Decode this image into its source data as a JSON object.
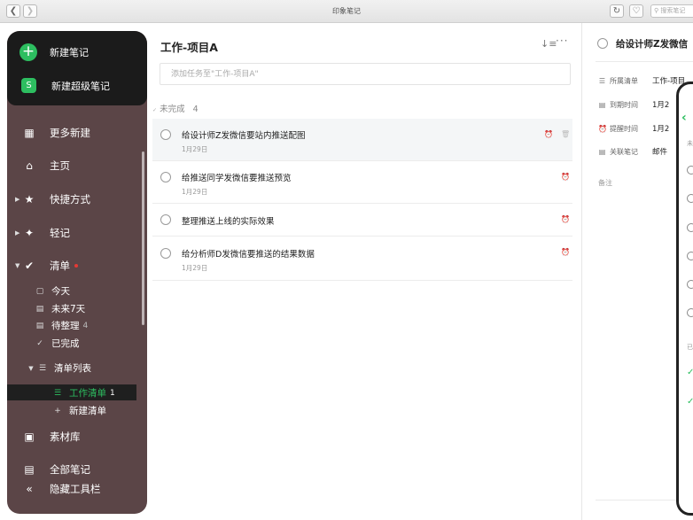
{
  "window": {
    "title": "印象笔记",
    "search_placeholder": "搜索笔记"
  },
  "sidebar": {
    "new_note": "新建笔记",
    "new_super_note": "新建超级笔记",
    "new_super_badge": "S",
    "more_new": "更多新建",
    "home": "主页",
    "shortcuts": "快捷方式",
    "quick_notes": "轻记",
    "lists": "清单",
    "today": "今天",
    "next7": "未来7天",
    "pending": "待整理",
    "pending_count": "4",
    "done": "已完成",
    "list_group": "清单列表",
    "work_list": "工作清单",
    "work_list_count": "1",
    "new_list": "新建清单",
    "materials": "素材库",
    "all_notes": "全部笔记",
    "hide_toolbar": "隐藏工具栏"
  },
  "tasklist": {
    "title": "工作-项目A",
    "add_placeholder": "添加任务至\"工作-项目A\"",
    "group_label": "未完成",
    "group_count": "4",
    "tasks": [
      {
        "title": "给设计师Z发微信要站内推送配图",
        "date": "1月29日"
      },
      {
        "title": "给推送同学发微信要推送预览",
        "date": "1月29日"
      },
      {
        "title": "整理推送上线的实际效果",
        "date": ""
      },
      {
        "title": "给分析师D发微信要推送的结果数据",
        "date": "1月29日"
      }
    ]
  },
  "detail": {
    "title": "给设计师Z发微信",
    "list_label": "所属清单",
    "list_value": "工作-项目",
    "due_label": "到期时间",
    "due_value": "1月2",
    "remind_label": "提醒时间",
    "remind_value": "1月2",
    "linked_label": "关联笔记",
    "linked_value": "邮件",
    "notes_label": "备注"
  },
  "phone": {
    "undone_mark": "未",
    "done_mark": "已"
  },
  "colors": {
    "accent": "#2dbe60",
    "sidebar_bg": "#5b4547",
    "sidebar_top": "#1b1b1b"
  }
}
